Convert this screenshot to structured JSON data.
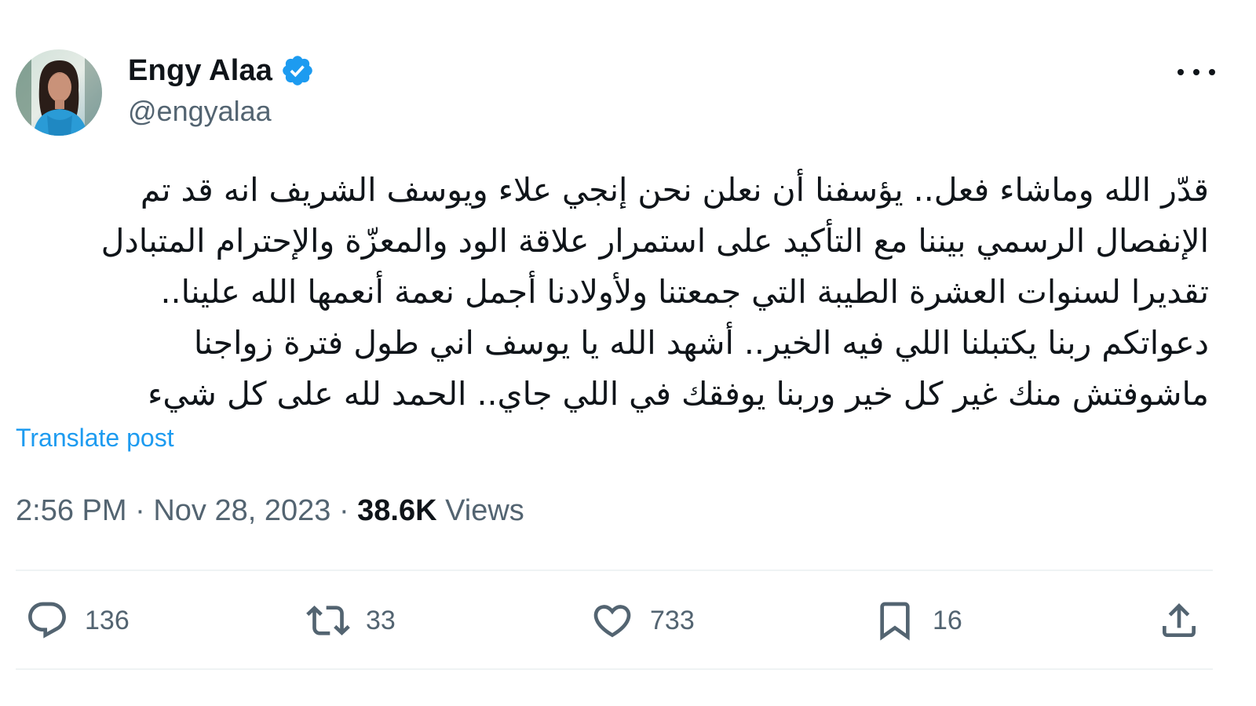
{
  "author": {
    "display_name": "Engy Alaa",
    "handle": "@engyalaa",
    "verified": true
  },
  "post": {
    "lines": [
      "قدّر الله وماشاء فعل.. يؤسفنا أن نعلن نحن إنجي علاء ويوسف الشريف انه قد تم",
      "الإنفصال الرسمي بيننا مع التأكيد على استمرار علاقة الود والمعزّة والإحترام المتبادل",
      "تقديرا لسنوات العشرة الطيبة التي جمعتنا ولأولادنا أجمل نعمة أنعمها الله علينا..",
      "دعواتكم ربنا يكتبلنا اللي فيه الخير.. أشهد الله يا يوسف اني طول فترة زواجنا",
      "ماشوفتش منك غير كل خير وربنا يوفقك في اللي جاي.. الحمد لله على كل شيء"
    ],
    "translate_label": "Translate post",
    "time": "2:56 PM",
    "date": "Nov 28, 2023",
    "views_count": "38.6K",
    "views_label": "Views"
  },
  "actions": {
    "reply_count": "136",
    "repost_count": "33",
    "like_count": "733",
    "bookmark_count": "16"
  },
  "icons": {
    "more": "more-horizontal-icon",
    "verified": "verified-badge-icon",
    "reply": "reply-icon",
    "repost": "repost-icon",
    "like": "heart-icon",
    "bookmark": "bookmark-icon",
    "share": "share-icon"
  },
  "colors": {
    "accent": "#1d9bf0",
    "text_primary": "#0f1419",
    "text_secondary": "#536471",
    "divider": "#eff3f4"
  }
}
